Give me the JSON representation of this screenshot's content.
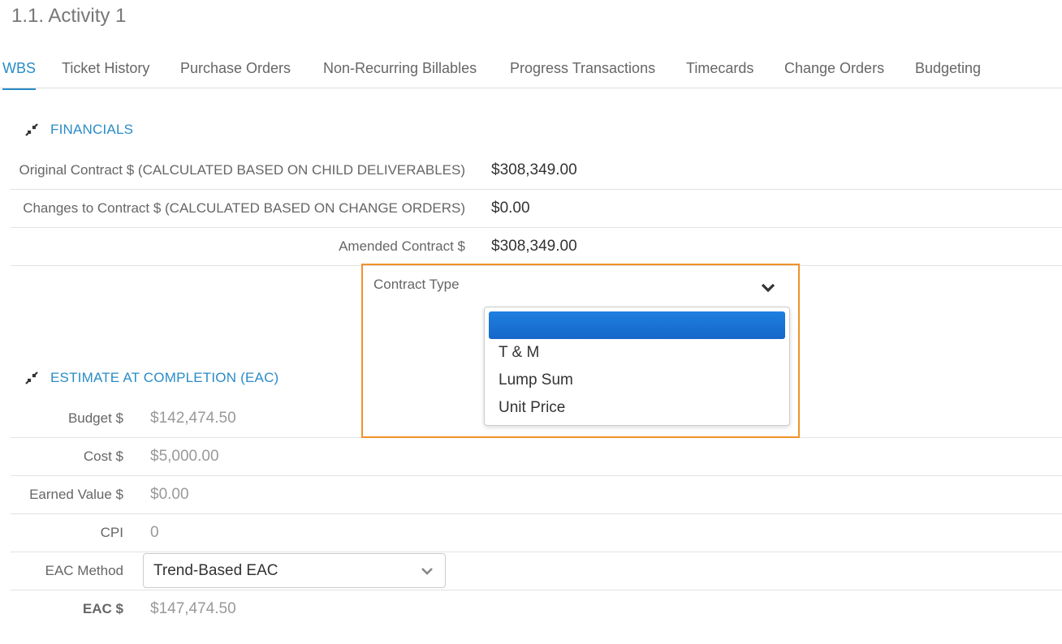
{
  "page_title": "1.1. Activity 1",
  "tabs": [
    {
      "label": "WBS",
      "active": true
    },
    {
      "label": "Ticket History"
    },
    {
      "label": "Purchase Orders"
    },
    {
      "label": "Non-Recurring Billables"
    },
    {
      "label": "Progress Transactions"
    },
    {
      "label": "Timecards"
    },
    {
      "label": "Change Orders"
    },
    {
      "label": "Budgeting"
    }
  ],
  "financials": {
    "title": "FINANCIALS",
    "icon": "collapse-icon",
    "rows": [
      {
        "label": "Original Contract $ (CALCULATED BASED ON CHILD DELIVERABLES)",
        "value": "$308,349.00"
      },
      {
        "label": "Changes to Contract $ (CALCULATED BASED ON CHANGE ORDERS)",
        "value": "$0.00"
      },
      {
        "label": "Amended Contract $",
        "value": "$308,349.00"
      }
    ],
    "contract_type": {
      "label": "Contract Type",
      "icon": "chevron-down-icon",
      "options": [
        "",
        "T & M",
        "Lump Sum",
        "Unit Price"
      ],
      "highlight_color": "#f0922a",
      "selected_color": "#1f7fe0"
    }
  },
  "eac": {
    "title": "ESTIMATE AT COMPLETION (EAC)",
    "icon": "collapse-icon",
    "rows": [
      {
        "label": "Budget $",
        "value": "$142,474.50"
      },
      {
        "label": "Cost $",
        "value": "$5,000.00"
      },
      {
        "label": "Earned Value $",
        "value": "$0.00"
      },
      {
        "label": "CPI",
        "value": "0"
      }
    ],
    "method": {
      "label": "EAC Method",
      "value": "Trend-Based EAC",
      "icon": "chevron-down-icon"
    },
    "total": {
      "label": "EAC $",
      "value": "$147,474.50"
    }
  },
  "accent_color": "#2a8cc7"
}
